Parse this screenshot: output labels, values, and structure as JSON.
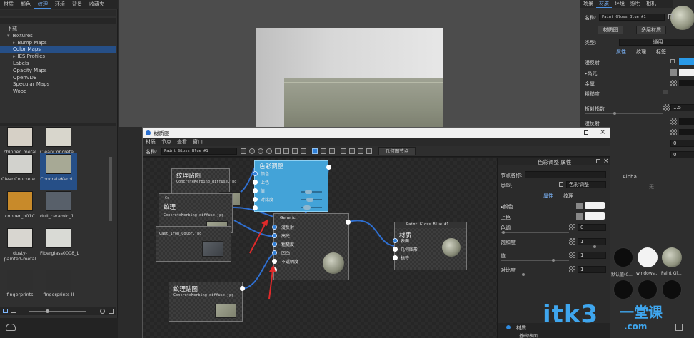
{
  "left_panel": {
    "tabs": [
      "材质",
      "颜色",
      "纹理",
      "环境",
      "背景",
      "收藏夹"
    ],
    "active_tab": 2,
    "tree": [
      {
        "label": "下载",
        "level": 0,
        "arrow": ""
      },
      {
        "label": "Textures",
        "level": 0,
        "arrow": "▾"
      },
      {
        "label": "Bump Maps",
        "level": 1,
        "arrow": "▸"
      },
      {
        "label": "Color Maps",
        "level": 1,
        "arrow": "",
        "selected": true
      },
      {
        "label": "IES Profiles",
        "level": 1,
        "arrow": "▸"
      },
      {
        "label": "Labels",
        "level": 1,
        "arrow": ""
      },
      {
        "label": "Opacity Maps",
        "level": 1,
        "arrow": ""
      },
      {
        "label": "OpenVDB",
        "level": 1,
        "arrow": ""
      },
      {
        "label": "Specular Maps",
        "level": 1,
        "arrow": ""
      },
      {
        "label": "Wood",
        "level": 1,
        "arrow": ""
      }
    ],
    "thumbnails": [
      {
        "label": "chipped metal",
        "color": "#d6d0c6"
      },
      {
        "label": "CleanConcrete...",
        "color": "#d8d6cc"
      },
      {
        "label": "CleanConcrete...",
        "color": "#d2d2cd"
      },
      {
        "label": "ConcreteKerbi...",
        "color": "#a7a995",
        "selected": true
      },
      {
        "label": "copper_h01C",
        "color": "#c88a2a"
      },
      {
        "label": "dull_ceramic_1...",
        "color": "#58606a"
      },
      {
        "label": "dusty-painted-metal",
        "color": "#d8d6d0"
      },
      {
        "label": "Fiberglass0008_L",
        "color": "#d9dad5"
      },
      {
        "label": "fingerprints",
        "color": "#2f2f2f"
      },
      {
        "label": "fingerprints-II",
        "color": "#2f2f2f"
      }
    ]
  },
  "right_panel": {
    "tabs": [
      "场景",
      "材质",
      "环境",
      "照明",
      "相机"
    ],
    "active_tab": 1,
    "name_label": "名称:",
    "name_value": "Paint Gloss Blue #1",
    "btn_material_graph": "材质图",
    "btn_multi_layer": "多层材质",
    "type_label": "类型:",
    "type_value": "通用",
    "subtabs": [
      "属性",
      "纹理",
      "标签"
    ],
    "rows": [
      "漫反射",
      "高光",
      "金属",
      "粗糙度",
      "折射指数",
      "漫反射"
    ],
    "ior_value": "1.5",
    "zero_value": "0"
  },
  "material_window": {
    "title": "材质图",
    "menu": [
      "材质",
      "节点",
      "查看",
      "窗口"
    ],
    "name_label": "名称:",
    "name_value": "Paint Gloss Blue #1",
    "geometry_node_button": "几何图节点",
    "nodes": {
      "texture_top": {
        "title": "纹理贴图",
        "file": "ConcreteKerbing_diffuse.jpg"
      },
      "texture_mid": {
        "title": "纹理",
        "file": "ConcreteKerbing_diffuse.jpg",
        "prefix": "Co"
      },
      "texture_low": {
        "file": "Cast_Iron_Color.jpg"
      },
      "texture_bottom": {
        "title": "纹理贴图",
        "file": "ConcreteKerbing_diffuse.jpg"
      },
      "color_adjust": {
        "title": "色彩调整",
        "inputs": [
          "颜色",
          "上色",
          "值",
          "对比度"
        ]
      },
      "generic": {
        "title": "Generic",
        "inputs": [
          "漫反射",
          "高光",
          "粗糙度",
          "凹凸",
          "不透明度"
        ]
      },
      "material": {
        "header": "Paint Gloss Blue #1",
        "title": "材质",
        "inputs": [
          "表面",
          "几何图形",
          "标签"
        ]
      }
    },
    "props_panel": {
      "title": "色彩调整 属性",
      "node_name_label": "节点名称:",
      "type_label": "类型:",
      "type_value": "色彩调整",
      "tabs": [
        "属性",
        "纹理"
      ],
      "rows": [
        {
          "label": "颜色",
          "value": ""
        },
        {
          "label": "上色",
          "value": ""
        },
        {
          "label": "色调",
          "value": "0"
        },
        {
          "label": "饱和度",
          "value": "1"
        },
        {
          "label": "值",
          "value": "1"
        },
        {
          "label": "对比度",
          "value": "1"
        }
      ]
    }
  },
  "right_bottom": {
    "alpha_label": "Alpha",
    "none_label": "无",
    "swatches": [
      {
        "label": "默认值(0...",
        "color": "#0d0d0d"
      },
      {
        "label": "windows...",
        "color": "#f3f3f3"
      },
      {
        "label": "Paint Gl...",
        "color": "#8f927e"
      }
    ],
    "bottom_row": [
      "材质"
    ],
    "bottom_row2": [
      "基础/表面"
    ]
  },
  "watermark": {
    "text": "itk3",
    "suffix": ".com",
    "cn": "一堂课"
  }
}
